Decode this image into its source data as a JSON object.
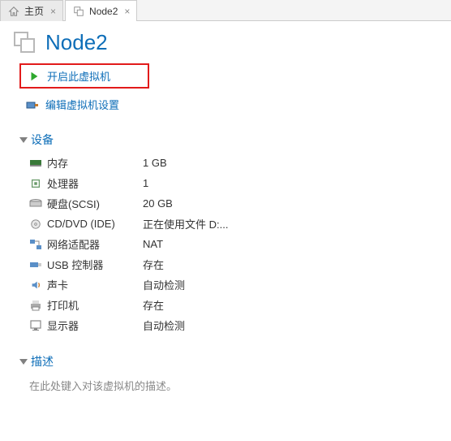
{
  "tabs": {
    "home": "主页",
    "node2": "Node2"
  },
  "title": "Node2",
  "actions": {
    "power_on": "开启此虚拟机",
    "edit_settings": "编辑虚拟机设置"
  },
  "sections": {
    "devices": "设备",
    "description": "描述"
  },
  "devices": {
    "memory": {
      "label": "内存",
      "value": "1 GB"
    },
    "cpu": {
      "label": "处理器",
      "value": "1"
    },
    "disk": {
      "label": "硬盘(SCSI)",
      "value": "20 GB"
    },
    "cd": {
      "label": "CD/DVD (IDE)",
      "value": "正在使用文件 D:..."
    },
    "net": {
      "label": "网络适配器",
      "value": "NAT"
    },
    "usb": {
      "label": "USB 控制器",
      "value": "存在"
    },
    "sound": {
      "label": "声卡",
      "value": "自动检测"
    },
    "printer": {
      "label": "打印机",
      "value": "存在"
    },
    "display": {
      "label": "显示器",
      "value": "自动检测"
    }
  },
  "description_placeholder": "在此处键入对该虚拟机的描述。"
}
